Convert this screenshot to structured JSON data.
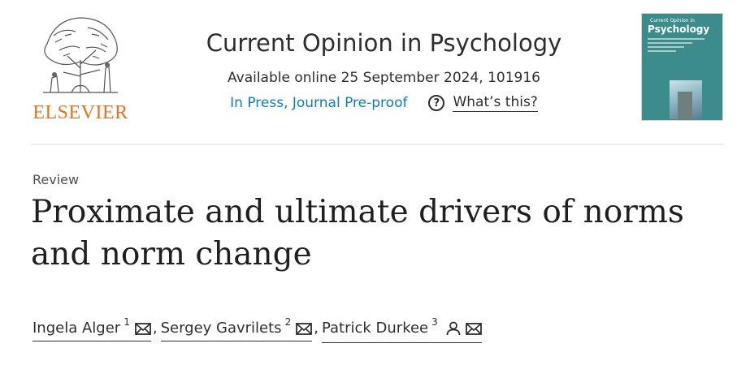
{
  "publisher": {
    "name": "ELSEVIER",
    "brand_color": "#e9711c",
    "logo_icon": "elsevier-tree-logo"
  },
  "journal": {
    "title": "Current Opinion in Psychology",
    "available_online": "Available online 25 September 2024, 101916",
    "status_link": "In Press, Journal Pre-proof",
    "status_color": "#0c7dbb",
    "help_icon": "question-circle-icon",
    "whats_this": "What’s this?"
  },
  "cover": {
    "line1": "Current Opinion in",
    "line2": "Psychology",
    "background_color": "#3d8c8c"
  },
  "article": {
    "type": "Review",
    "title": "Proximate and ultimate drivers of norms and norm change"
  },
  "authors": [
    {
      "name": "Ingela Alger",
      "sup": "1",
      "icons": [
        "envelope-icon"
      ]
    },
    {
      "name": "Sergey Gavrilets",
      "sup": "2",
      "icons": [
        "envelope-icon"
      ]
    },
    {
      "name": "Patrick Durkee",
      "sup": "3",
      "icons": [
        "person-icon",
        "envelope-icon"
      ]
    }
  ],
  "author_separator": ","
}
